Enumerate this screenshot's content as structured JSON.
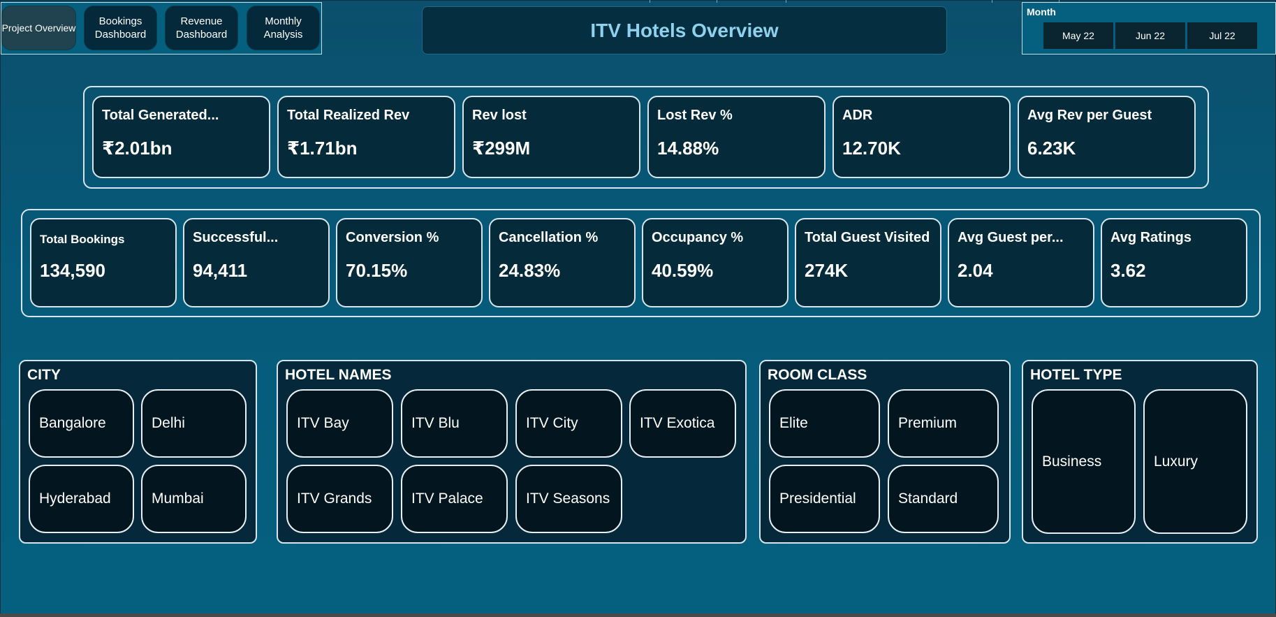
{
  "nav": {
    "project_overview": "Project Overview",
    "bookings_dashboard": "Bookings Dashboard",
    "revenue_dashboard": "Revenue Dashboard",
    "monthly_analysis": "Monthly Analysis"
  },
  "title": "ITV Hotels Overview",
  "month_slicer": {
    "label": "Month",
    "options": [
      "May 22",
      "Jun 22",
      "Jul 22"
    ]
  },
  "kpi_row1": [
    {
      "label": "Total Generated...",
      "value": "₹2.01bn"
    },
    {
      "label": "Total Realized Rev",
      "value": "₹1.71bn"
    },
    {
      "label": "Rev lost",
      "value": "₹299M"
    },
    {
      "label": "Lost Rev %",
      "value": "14.88%"
    },
    {
      "label": "ADR",
      "value": "12.70K"
    },
    {
      "label": "Avg Rev per Guest",
      "value": "6.23K"
    }
  ],
  "kpi_row2": [
    {
      "label": "Total Bookings",
      "value": "134,590"
    },
    {
      "label": "Successful...",
      "value": "94,411"
    },
    {
      "label": "Conversion %",
      "value": "70.15%"
    },
    {
      "label": "Cancellation %",
      "value": "24.83%"
    },
    {
      "label": "Occupancy %",
      "value": "40.59%"
    },
    {
      "label": "Total Guest Visited",
      "value": "274K"
    },
    {
      "label": "Avg Guest per...",
      "value": "2.04"
    },
    {
      "label": "Avg Ratings",
      "value": "3.62"
    }
  ],
  "city": {
    "title": "CITY",
    "items": [
      "Bangalore",
      "Delhi",
      "Hyderabad",
      "Mumbai"
    ]
  },
  "hotel_names": {
    "title": "HOTEL NAMES",
    "items": [
      "ITV Bay",
      "ITV Blu",
      "ITV City",
      "ITV Exotica",
      "ITV Grands",
      "ITV Palace",
      "ITV Seasons"
    ]
  },
  "room_class": {
    "title": "ROOM CLASS",
    "items": [
      "Elite",
      "Premium",
      "Presidential",
      "Standard"
    ]
  },
  "hotel_type": {
    "title": "HOTEL TYPE",
    "items": [
      "Business",
      "Luxury"
    ]
  }
}
